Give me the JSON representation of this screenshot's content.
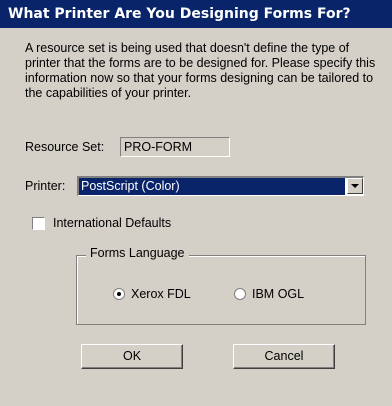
{
  "dialog": {
    "title": "What Printer Are You Designing Forms For?",
    "description": "A resource set is being used that doesn't define the type of printer that the forms are to be designed for.  Please specify this information now so that your forms designing can be tailored to the capabilities of your printer."
  },
  "resource_set": {
    "label": "Resource Set:",
    "value": "PRO-FORM"
  },
  "printer": {
    "label": "Printer:",
    "selected": "PostScript (Color)"
  },
  "international_defaults": {
    "label": "International Defaults",
    "checked": false
  },
  "forms_language": {
    "title": "Forms Language",
    "options": [
      {
        "label": "Xerox FDL",
        "selected": true
      },
      {
        "label": "IBM OGL",
        "selected": false
      }
    ]
  },
  "buttons": {
    "ok": "OK",
    "cancel": "Cancel"
  }
}
